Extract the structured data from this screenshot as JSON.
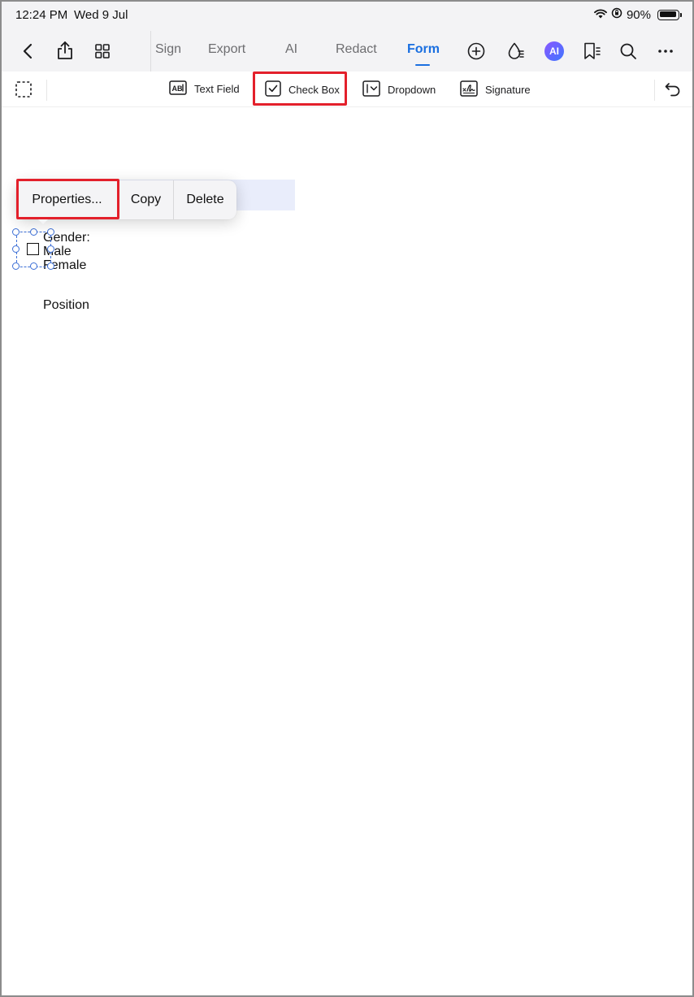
{
  "status_bar": {
    "time": "12:24 PM",
    "date": "Wed 9 Jul",
    "battery": "90%",
    "icons": [
      "wifi-icon",
      "orientation-lock-icon",
      "battery-icon"
    ]
  },
  "nav": {
    "left_icons": [
      "back-icon",
      "share-icon",
      "grid-icon"
    ],
    "tabs": [
      {
        "label": "Sign"
      },
      {
        "label": "Export"
      },
      {
        "label": "AI"
      },
      {
        "label": "Redact"
      },
      {
        "label": "Form"
      }
    ],
    "active_tab": "Form",
    "right_icons": [
      "add-circle-icon",
      "ink-drop-icon",
      "ai-assistant-icon",
      "bookmark-icon",
      "search-icon",
      "more-icon"
    ],
    "ai_badge": "AI",
    "accent_color": "#1a6fe0"
  },
  "toolbar": {
    "left_icon": "selection-icon",
    "items": [
      {
        "label": "Text Field",
        "icon": "text-field-icon"
      },
      {
        "label": "Check Box",
        "icon": "check-box-icon"
      },
      {
        "label": "Dropdown",
        "icon": "dropdown-icon"
      },
      {
        "label": "Signature",
        "icon": "signature-icon"
      }
    ],
    "highlighted_item": "Check Box",
    "right_icon": "undo-icon",
    "highlight_color": "#e3202b"
  },
  "context_menu": {
    "items": [
      {
        "label": "Properties..."
      },
      {
        "label": "Copy"
      },
      {
        "label": "Delete"
      }
    ],
    "highlighted_item": "Properties..."
  },
  "document": {
    "gender_label": "Gender:",
    "option_male": "Male",
    "option_female": "Female",
    "position_label": "Position"
  }
}
